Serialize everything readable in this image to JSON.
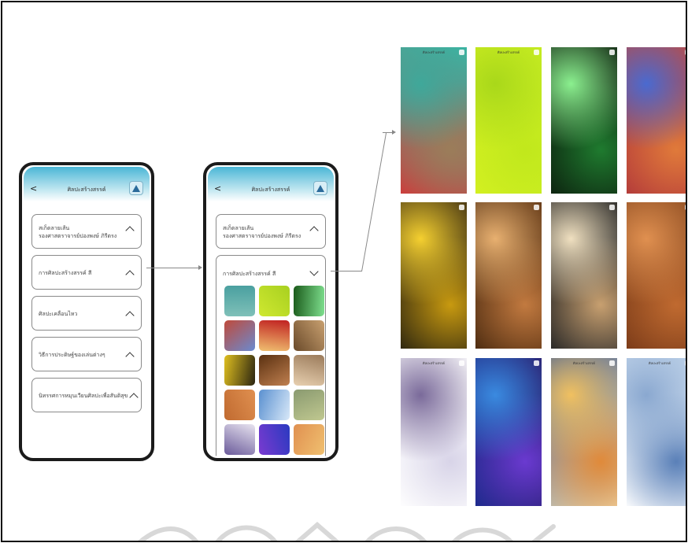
{
  "phone_left": {
    "title": "ศิลปะสร้างสรรค์",
    "back": "<",
    "items": [
      {
        "line1": "สเก็ตลายเส้น",
        "line2": "รองศาสตราจารย์ปองพงษ์ ภิรีตรง"
      },
      {
        "line1": "การศิลปะสร้างสรรค์ สี",
        "line2": ""
      },
      {
        "line1": "ศิลปะเคลื่อนไหว",
        "line2": ""
      },
      {
        "line1": "วิธีการประดิษฐ์ของเล่นต่างๆ",
        "line2": ""
      },
      {
        "line1": "นิทรรศการหมุนเวียนศิลปะเพื่อสันติสุข",
        "line2": ""
      }
    ]
  },
  "phone_middle": {
    "title": "ศิลปะสร้างสรรค์",
    "back": "<",
    "items": [
      {
        "line1": "สเก็ตลายเส้น",
        "line2": "รองศาสตราจารย์ปองพงษ์ ภิรีตรง"
      },
      {
        "line1": "การศิลปะสร้างสรรค์ สี",
        "line2": ""
      }
    ]
  },
  "gallery": {
    "row1": [
      {
        "title": "ศิลปะสร้างสรรค์",
        "colors": [
          "#cf3a3a",
          "#9b7d5a",
          "#3fa89a",
          "#3ab6a4"
        ]
      },
      {
        "title": "ศิลปะสร้างสรรค์",
        "colors": [
          "#d4f021",
          "#c1e81c",
          "#a9d81a",
          "#c8ee22"
        ]
      },
      {
        "title": "",
        "colors": [
          "#0b1b0b",
          "#1f7b2f",
          "#8bf08f",
          "#0d2410"
        ]
      },
      {
        "title": "",
        "colors": [
          "#c54a3a",
          "#e07a3a",
          "#4a6ad0",
          "#b23a3a"
        ]
      }
    ],
    "row2": [
      {
        "title": "",
        "colors": [
          "#2a2410",
          "#c89a10",
          "#f5d030",
          "#3a2a10"
        ]
      },
      {
        "title": "",
        "colors": [
          "#4a2a10",
          "#c27a40",
          "#e8b070",
          "#5a3010"
        ]
      },
      {
        "title": "",
        "colors": [
          "#1a1a1a",
          "#c8a070",
          "#f0e0c0",
          "#2a2a2a"
        ]
      },
      {
        "title": "",
        "colors": [
          "#8a4a20",
          "#c06a30",
          "#e09050",
          "#7a3a18"
        ]
      }
    ],
    "row3": [
      {
        "title": "ศิลปะสร้างสรรค์",
        "colors": [
          "#ffffff",
          "#d8d4e8",
          "#7a6a9a",
          "#ffffff"
        ]
      },
      {
        "title": "",
        "colors": [
          "#1a2a8a",
          "#6a3ad0",
          "#3a8ae0",
          "#2a1a6a"
        ]
      },
      {
        "title": "ศิลปะสร้างสรรค์",
        "colors": [
          "#3a5a9a",
          "#e08a3a",
          "#f0c060",
          "#eedcb0"
        ]
      },
      {
        "title": "ศิลปะสร้างสรรค์",
        "colors": [
          "#c0d4ea",
          "#5a80b8",
          "#8aa8d0",
          "#ffffff"
        ]
      }
    ]
  },
  "thumb_colors": [
    [
      "#7fc0b8",
      "#4aa0a0"
    ],
    [
      "#cfe830",
      "#a8d020"
    ],
    [
      "#1a5a1a",
      "#7fe08f"
    ],
    [
      "#c04a3a",
      "#6a8ad0"
    ],
    [
      "#c02020",
      "#f0c070"
    ],
    [
      "#c8a070",
      "#6a4a2a"
    ],
    [
      "#2a2410",
      "#e0c020"
    ],
    [
      "#c08050",
      "#5a3010"
    ],
    [
      "#e8d0b0",
      "#9a7a5a"
    ],
    [
      "#c06a30",
      "#e09050"
    ],
    [
      "#5a90d0",
      "#d8e8f8"
    ],
    [
      "#8a9a70",
      "#c0c890"
    ],
    [
      "#e8e4f0",
      "#6a5a9a"
    ],
    [
      "#2a3ac0",
      "#7a3ad0"
    ],
    [
      "#f0c070",
      "#e09050"
    ]
  ]
}
